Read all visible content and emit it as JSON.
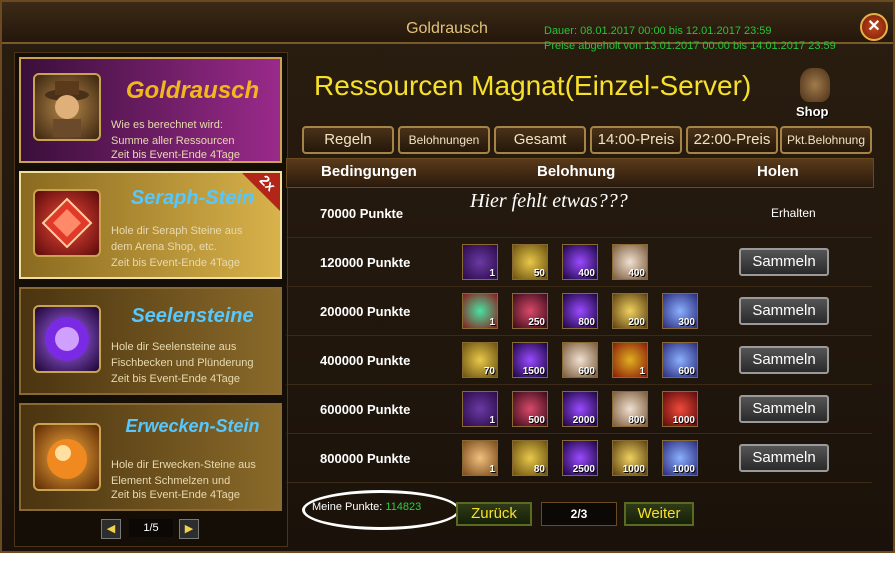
{
  "window": {
    "title": "Goldrausch",
    "dates_line1": "Dauer: 08.01.2017 00:00 bis 12.01.2017 23:59",
    "dates_line2": "Preise abgeholt von 13.01.2017 00:00 bis 14.01.2017 23:59",
    "close_icon": "close-icon"
  },
  "sidebar": {
    "cards": [
      {
        "title": "Goldrausch",
        "line1": "Wie es berechnet wird:",
        "line2": "Summe aller Ressourcen",
        "time": "Zeit bis Event-Ende 4Tage",
        "icon": "prospector-portrait-icon",
        "title_color": "#f1b81e"
      },
      {
        "title": "Seraph-Stein",
        "line1": "Hole dir Seraph Steine aus",
        "line2": "dem Arena Shop, etc.",
        "time": "Zeit bis Event-Ende 4Tage",
        "icon": "seraph-stone-icon",
        "badge": "2x",
        "title_color": "#55c8ff"
      },
      {
        "title": "Seelensteine",
        "line1": "Hole dir Seelensteine aus",
        "line2": "Fischbecken und Plünderung",
        "time": "Zeit bis Event-Ende 4Tage",
        "icon": "soul-stone-icon",
        "title_color": "#55c8ff"
      },
      {
        "title": "Erwecken-Stein",
        "line1": "Hole dir Erwecken-Steine aus",
        "line2": "Element Schmelzen und",
        "time": "Zeit bis Event-Ende 4Tage",
        "icon": "awakening-stone-icon",
        "title_color": "#55c8ff"
      }
    ],
    "pager": {
      "label": "1/5"
    }
  },
  "main": {
    "title": "Ressourcen Magnat(Einzel-Server)",
    "shop_label": "Shop",
    "tabs": [
      "Regeln",
      "Belohnungen",
      "Gesamt",
      "14:00-Preis",
      "22:00-Preis",
      "Pkt.Belohnung"
    ],
    "columns": {
      "conditions": "Bedingungen",
      "reward": "Belohnung",
      "collect": "Holen"
    },
    "hint": "Hier fehlt etwas???",
    "rows": [
      {
        "points": "70000  Punkte",
        "status": "Erhalten",
        "items": []
      },
      {
        "points": "120000  Punkte",
        "button": "Sammeln",
        "items": [
          {
            "icon": "purple-chest-icon",
            "qty": "1"
          },
          {
            "icon": "gold-scroll-icon",
            "qty": "50"
          },
          {
            "icon": "purple-orb-icon",
            "qty": "400"
          },
          {
            "icon": "pearl-orb-icon",
            "qty": "400"
          }
        ]
      },
      {
        "points": "200000  Punkte",
        "button": "Sammeln",
        "items": [
          {
            "icon": "green-gem-icon",
            "qty": "1"
          },
          {
            "icon": "red-pouch-icon",
            "qty": "250"
          },
          {
            "icon": "purple-orb-icon",
            "qty": "800"
          },
          {
            "icon": "gold-crystal-icon",
            "qty": "200"
          },
          {
            "icon": "blue-crystal-icon",
            "qty": "300"
          }
        ]
      },
      {
        "points": "400000  Punkte",
        "button": "Sammeln",
        "items": [
          {
            "icon": "gold-scroll-icon",
            "qty": "70"
          },
          {
            "icon": "purple-orb-icon",
            "qty": "1500"
          },
          {
            "icon": "pearl-orb-icon",
            "qty": "600"
          },
          {
            "icon": "dragon-chest-icon",
            "qty": "1"
          },
          {
            "icon": "blue-crystal-icon",
            "qty": "600"
          }
        ]
      },
      {
        "points": "600000  Punkte",
        "button": "Sammeln",
        "items": [
          {
            "icon": "purple-chest-icon",
            "qty": "1"
          },
          {
            "icon": "red-pouch-icon",
            "qty": "500"
          },
          {
            "icon": "purple-orb-icon",
            "qty": "2000"
          },
          {
            "icon": "pearl-orb-icon",
            "qty": "800"
          },
          {
            "icon": "seraph-stone-icon",
            "qty": "1000"
          }
        ]
      },
      {
        "points": "800000  Punkte",
        "button": "Sammeln",
        "items": [
          {
            "icon": "heart-crystal-icon",
            "qty": "1"
          },
          {
            "icon": "gold-scroll-icon",
            "qty": "80"
          },
          {
            "icon": "purple-orb-icon",
            "qty": "2500"
          },
          {
            "icon": "gold-crystal-icon",
            "qty": "1000"
          },
          {
            "icon": "blue-crystal-icon",
            "qty": "1000"
          }
        ]
      }
    ],
    "my_points_label": "Meine Punkte:",
    "my_points_value": "114823",
    "back_label": "Zurück",
    "page_label": "2/3",
    "next_label": "Weiter"
  },
  "colors": {
    "title_yellow": "#f7e02a",
    "green_text": "#27c43a",
    "gold_border": "#a58446"
  }
}
